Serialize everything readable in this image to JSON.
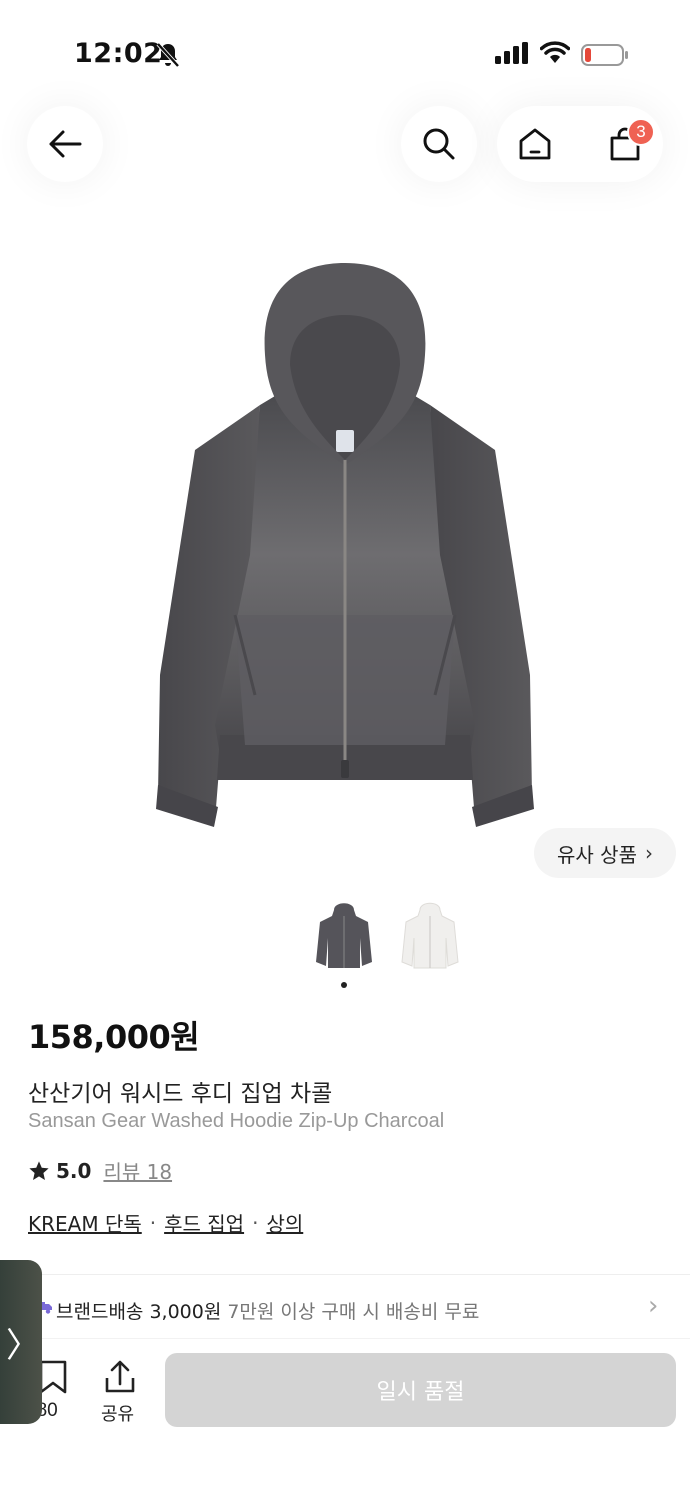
{
  "status_bar": {
    "time": "12:02",
    "icons": [
      "bell-slash-icon",
      "cellular-signal-icon",
      "wifi-icon",
      "battery-low-icon"
    ],
    "battery_color": "#e5483a"
  },
  "nav": {
    "back_icon": "arrow-left-icon",
    "search_icon": "search-icon",
    "home_icon": "home-icon",
    "cart_icon": "shopping-bag-icon",
    "cart_badge": "3",
    "badge_color": "#ef6253"
  },
  "gallery": {
    "similar_button_label": "유사 상품",
    "similar_chevron": "›",
    "thumbnails": [
      "charcoal",
      "white"
    ],
    "active_index": 0
  },
  "product": {
    "price": "158,000원",
    "name_ko": "산산기어 워시드 후디 집업 차콜",
    "name_en": "Sansan Gear Washed Hoodie Zip-Up Charcoal",
    "rating": "5.0",
    "review_label": "리뷰 18",
    "tags": [
      "KREAM 단독",
      "후드 집업",
      "상의"
    ],
    "tag_separator": "·"
  },
  "shipping": {
    "label": "브랜드배송 3,000원",
    "sub": "7만원 이상 구매 시 배송비 무료",
    "icon": "truck-icon"
  },
  "bottom": {
    "save_count": "680",
    "share_label": "공유",
    "soldout_label": "일시 품절",
    "edge_tab_glyph": "〉"
  }
}
